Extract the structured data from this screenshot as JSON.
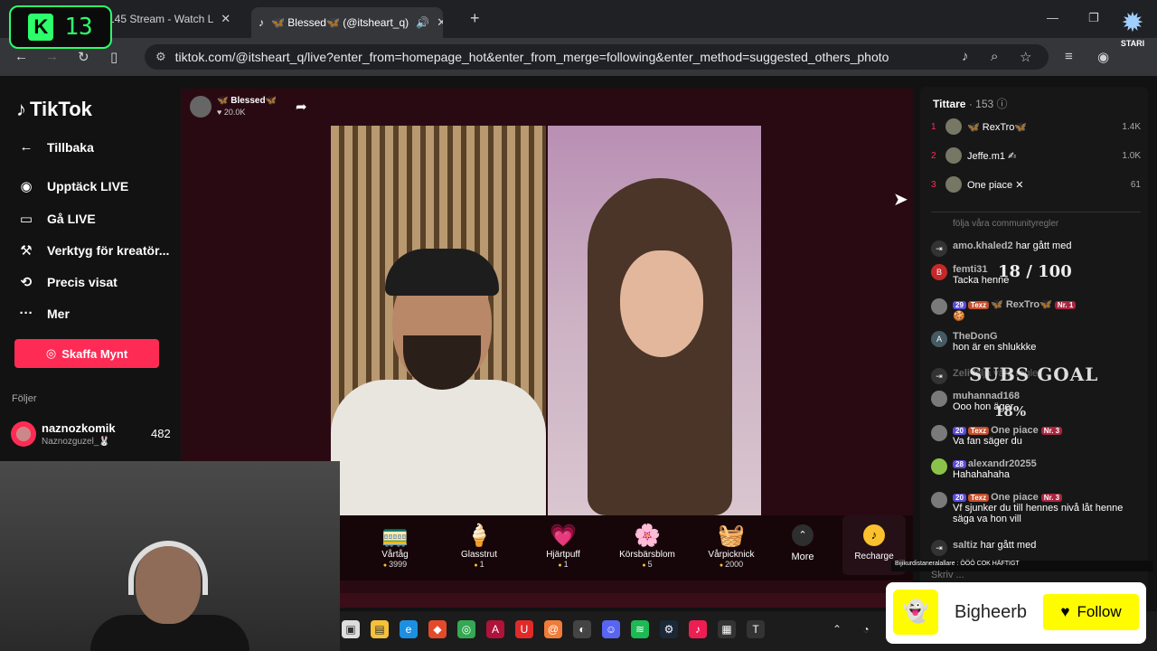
{
  "browser": {
    "tabs": [
      {
        "title": "145 Stream - Watch L"
      },
      {
        "title": "🦋 Blessed🦋 (@itsheart_q)"
      }
    ],
    "url": "tiktok.com/@itsheart_q/live?enter_from=homepage_hot&enter_from_merge=following&enter_method=suggested_others_photo",
    "new_tab": "+"
  },
  "overlay_badge": {
    "letter": "K",
    "number": "13"
  },
  "stari_logo": {
    "text": "STARI"
  },
  "sidebar": {
    "logo": "TikTok",
    "back": "Tillbaka",
    "items": [
      {
        "label": "Upptäck LIVE",
        "icon": "live-discover-icon"
      },
      {
        "label": "Gå LIVE",
        "icon": "camera-icon"
      },
      {
        "label": "Verktyg för kreatör...",
        "icon": "tools-icon"
      },
      {
        "label": "Precis visat",
        "icon": "history-icon"
      },
      {
        "label": "Mer",
        "icon": "more-icon"
      }
    ],
    "coins_button": "Skaffa Mynt",
    "following_label": "Följer",
    "following": [
      {
        "name": "naznozkomik",
        "handle": "Naznozguzel_🐰",
        "count": "482"
      }
    ]
  },
  "streamer": {
    "name": "🦋 Blessed🦋",
    "likes": "♥ 20.0K"
  },
  "gifts": [
    {
      "name": "Vårtåg",
      "price": "3999",
      "icon": "🚃"
    },
    {
      "name": "Glasstrut",
      "price": "1",
      "icon": "🍦"
    },
    {
      "name": "Hjärtpuff",
      "price": "1",
      "icon": "💗"
    },
    {
      "name": "Körsbärsblom",
      "price": "5",
      "icon": "🌸"
    },
    {
      "name": "Vårpicknick",
      "price": "2000",
      "icon": "🧺"
    }
  ],
  "more_label": "More",
  "recharge_label": "Recharge",
  "viewers": {
    "label": "Tittare",
    "count": "· 153",
    "top": [
      {
        "rank": "1",
        "name": "🦋 RexTro🦋",
        "score": "1.4K"
      },
      {
        "rank": "2",
        "name": "Jeffe.m1 ✍",
        "score": "1.0K"
      },
      {
        "rank": "3",
        "name": "One piace ✕",
        "score": "61"
      }
    ]
  },
  "chat": {
    "rules_hint": "följa våra communityregler",
    "messages": [
      {
        "user": "amo.khaled2",
        "text": "har gått med"
      },
      {
        "user": "femti31",
        "text": "Tacka henne"
      },
      {
        "user": "🦋 RexTro🦋",
        "text": "🍪",
        "lvl": "29",
        "texz": "Texz",
        "nr": "Nr. 1"
      },
      {
        "user": "TheDonG",
        "text": "hon är en shlukkke"
      },
      {
        "user": "Zeli",
        "text": "följa våra regler"
      },
      {
        "user": "muhannad168",
        "text": "Ooo hon äger"
      },
      {
        "user": "One piace",
        "text": "Va fan säger du",
        "lvl": "20",
        "texz": "Texz",
        "nr": "Nr. 3"
      },
      {
        "user": "alexandr20255",
        "text": "Hahahahaha",
        "lvl": "28"
      },
      {
        "user": "One piace",
        "text": "Vf sjunker du till hennes nivå låt henne säga va hon vill",
        "lvl": "20",
        "texz": "Texz",
        "nr": "Nr. 3"
      },
      {
        "user": "saltiz",
        "text": "har gått med"
      }
    ],
    "input_placeholder": "Skriv ..."
  },
  "subs_overlay": {
    "counter": "18 / 100",
    "goal": "SUBS GOAL",
    "percent": "18%"
  },
  "ticker": "Bijikurdistaneralallare : ÖÖÖ COK HÄFTIGT",
  "follow_widget": {
    "name": "Bigheerb",
    "button": "Follow"
  }
}
